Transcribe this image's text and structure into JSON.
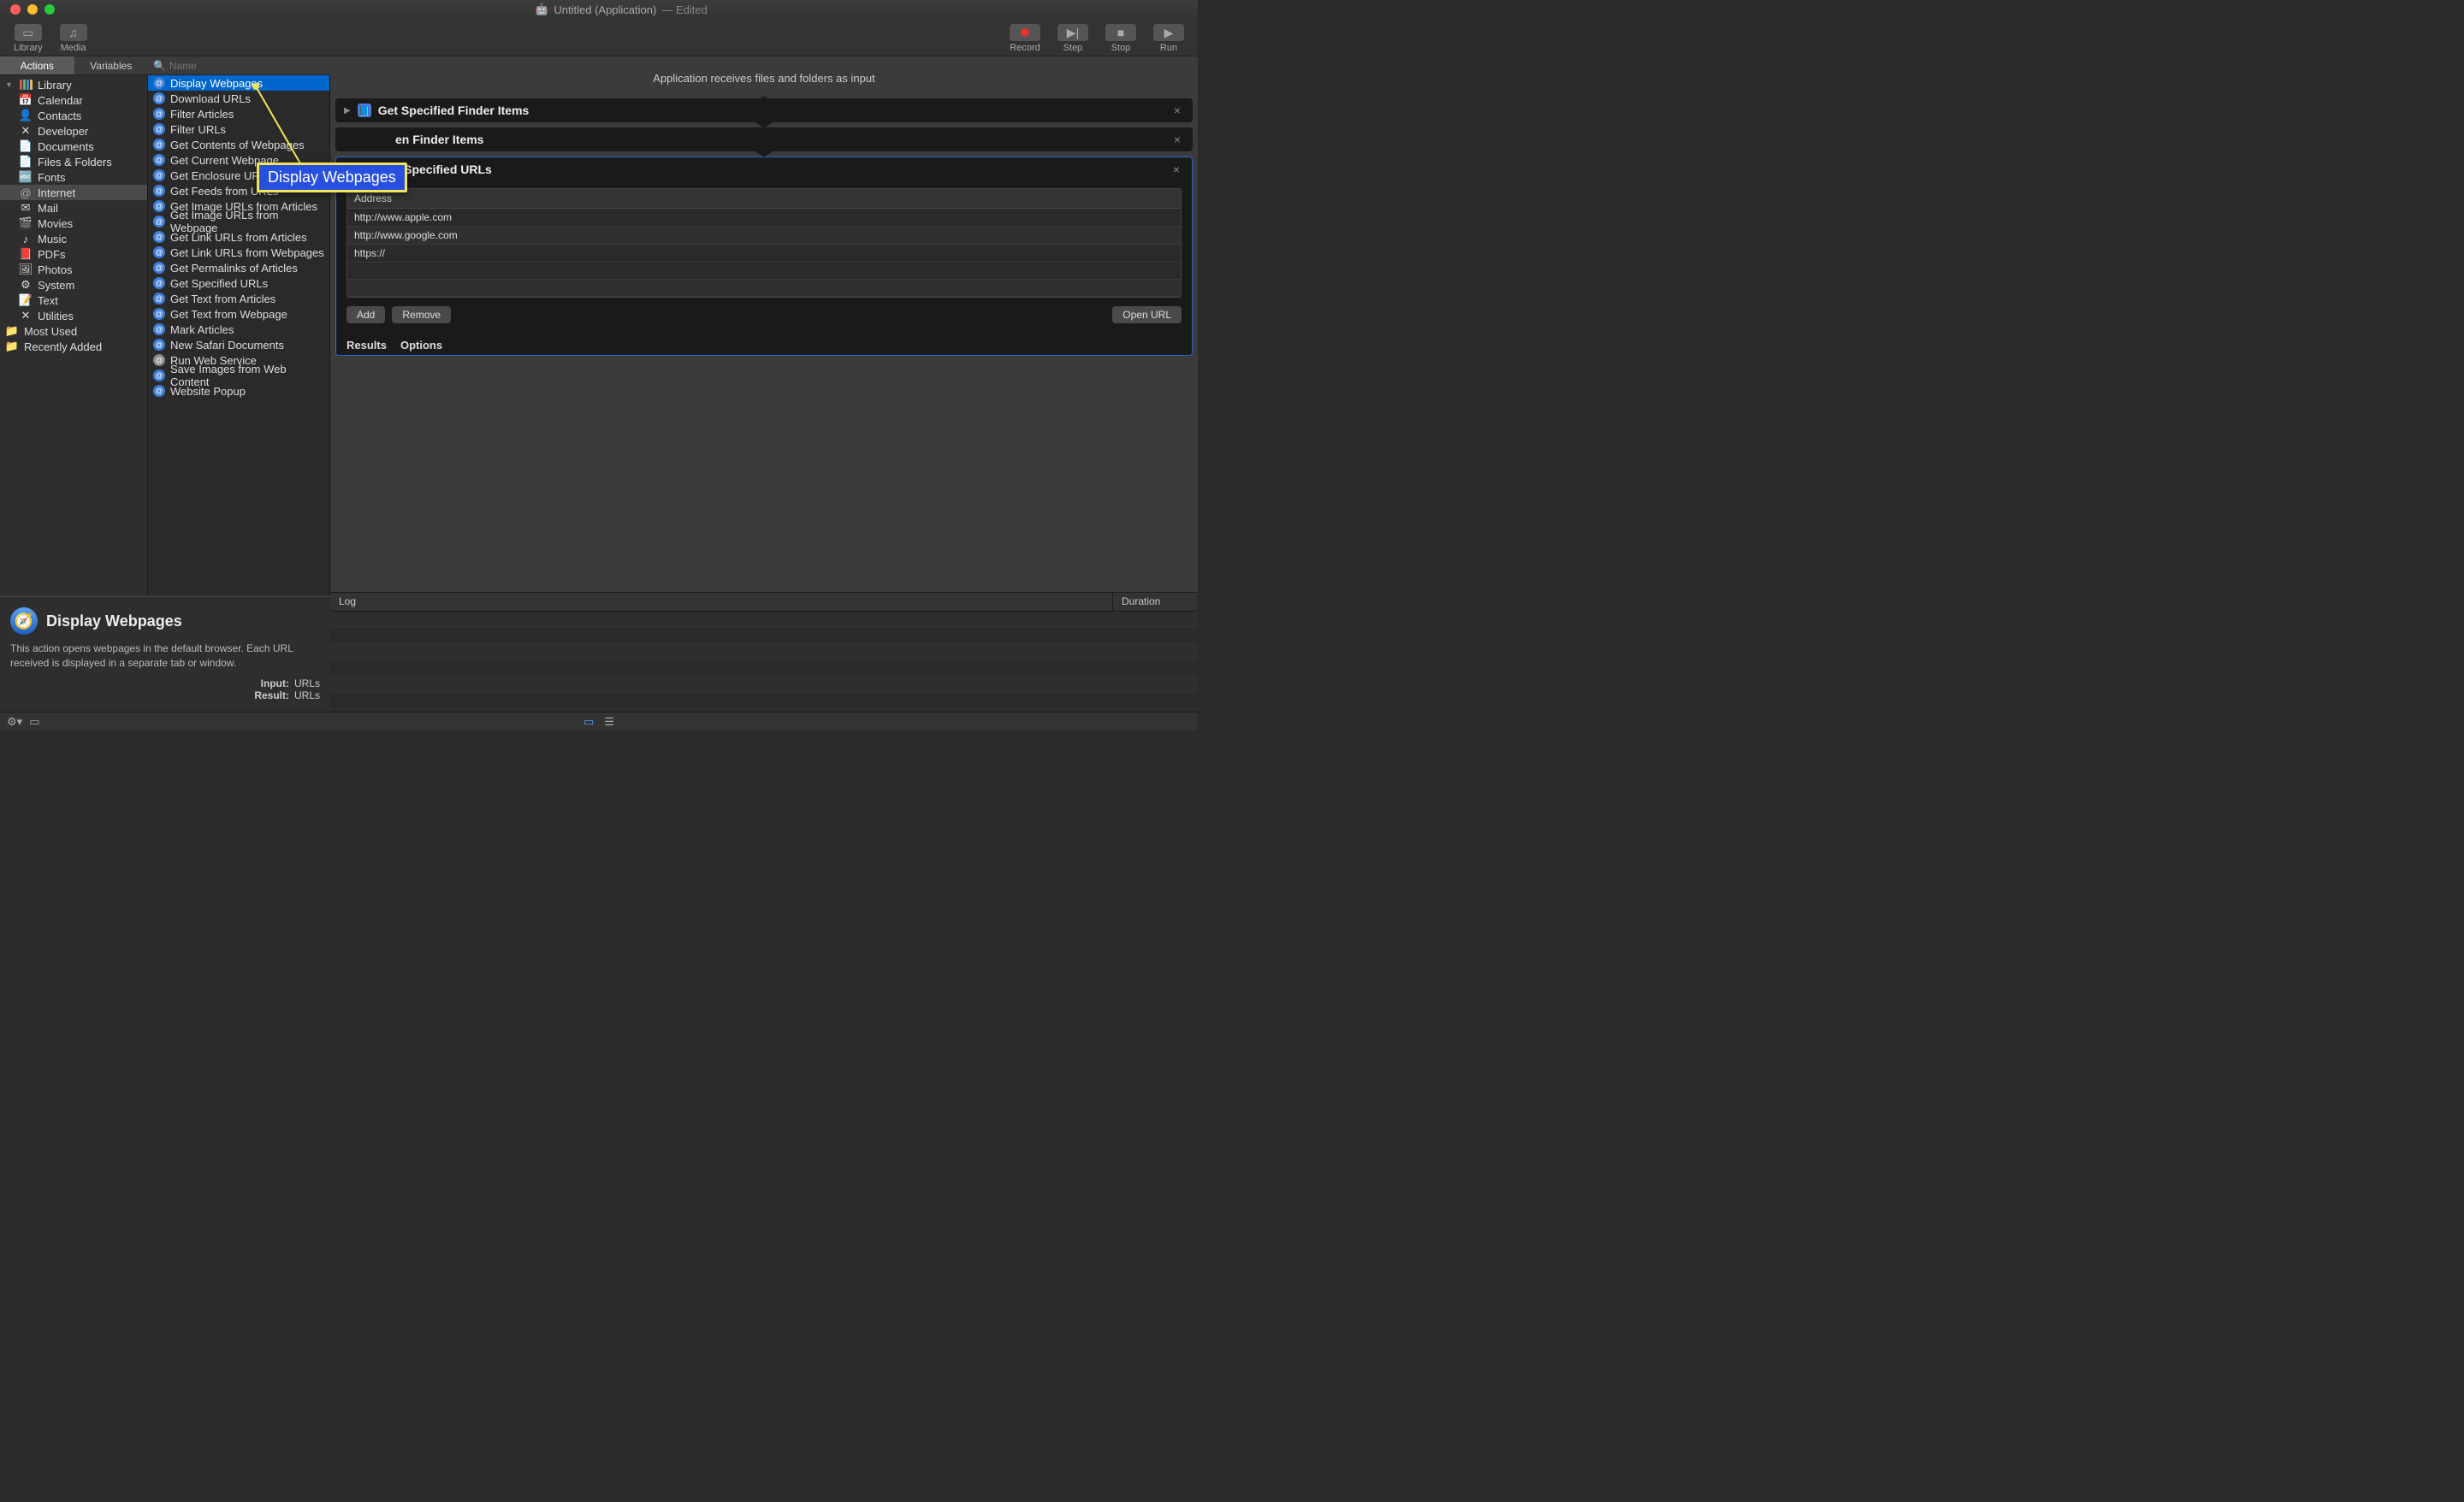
{
  "window": {
    "title": "Untitled (Application)",
    "status": "— Edited"
  },
  "toolbar": {
    "library": "Library",
    "media": "Media",
    "record": "Record",
    "step": "Step",
    "stop": "Stop",
    "run": "Run"
  },
  "tabs": {
    "actions": "Actions",
    "variables": "Variables"
  },
  "search": {
    "placeholder": "Name"
  },
  "library": {
    "root": "Library",
    "items": [
      {
        "label": "Calendar",
        "icon": "📅"
      },
      {
        "label": "Contacts",
        "icon": "👤"
      },
      {
        "label": "Developer",
        "icon": "✕"
      },
      {
        "label": "Documents",
        "icon": "📄"
      },
      {
        "label": "Files & Folders",
        "icon": "📄"
      },
      {
        "label": "Fonts",
        "icon": "🔤"
      },
      {
        "label": "Internet",
        "icon": "@",
        "selected": true
      },
      {
        "label": "Mail",
        "icon": "✉"
      },
      {
        "label": "Movies",
        "icon": "🎬"
      },
      {
        "label": "Music",
        "icon": "♪"
      },
      {
        "label": "PDFs",
        "icon": "📕"
      },
      {
        "label": "Photos",
        "icon": "🖼"
      },
      {
        "label": "System",
        "icon": "⚙"
      },
      {
        "label": "Text",
        "icon": "📝"
      },
      {
        "label": "Utilities",
        "icon": "✕"
      }
    ],
    "folders": [
      {
        "label": "Most Used"
      },
      {
        "label": "Recently Added"
      }
    ]
  },
  "actions": [
    {
      "label": "Display Webpages",
      "selected": true
    },
    {
      "label": "Download URLs"
    },
    {
      "label": "Filter Articles"
    },
    {
      "label": "Filter URLs"
    },
    {
      "label": "Get Contents of Webpages"
    },
    {
      "label": "Get Current Webpage"
    },
    {
      "label": "Get Enclosure URLs"
    },
    {
      "label": "Get Feeds from URLs"
    },
    {
      "label": "Get Image URLs from Articles"
    },
    {
      "label": "Get Image URLs from Webpage"
    },
    {
      "label": "Get Link URLs from Articles"
    },
    {
      "label": "Get Link URLs from Webpages"
    },
    {
      "label": "Get Permalinks of Articles"
    },
    {
      "label": "Get Specified URLs"
    },
    {
      "label": "Get Text from Articles"
    },
    {
      "label": "Get Text from Webpage"
    },
    {
      "label": "Mark Articles"
    },
    {
      "label": "New Safari Documents"
    },
    {
      "label": "Run Web Service",
      "gray": true
    },
    {
      "label": "Save Images from Web Content"
    },
    {
      "label": "Website Popup"
    }
  ],
  "description": {
    "title": "Display Webpages",
    "text": "This action opens webpages in the default browser. Each URL received is displayed in a separate tab or window.",
    "input_label": "Input:",
    "input_value": "URLs",
    "result_label": "Result:",
    "result_value": "URLs"
  },
  "workflow": {
    "receives_text": "Application receives files and folders as input",
    "actions": [
      {
        "title": "Get Specified Finder Items",
        "expanded": false,
        "icon_bg": "#4a7dd8"
      },
      {
        "title": "en Finder Items",
        "expanded": false,
        "icon_bg": "#4a7dd8",
        "partial": true
      }
    ],
    "url_action": {
      "title": "Get Specified URLs",
      "address_label": "Address",
      "urls": [
        "http://www.apple.com",
        "http://www.google.com",
        "https://"
      ],
      "add": "Add",
      "remove": "Remove",
      "open_url": "Open URL",
      "results": "Results",
      "options": "Options"
    }
  },
  "log": {
    "log_label": "Log",
    "duration_label": "Duration"
  },
  "callout": {
    "text": "Display Webpages"
  }
}
